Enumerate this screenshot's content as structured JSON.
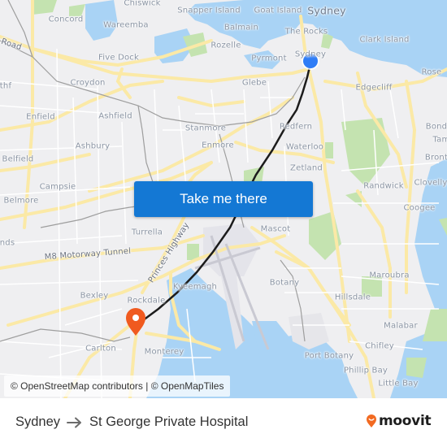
{
  "map": {
    "colors": {
      "land": "#efeff1",
      "water": "#a9d3f5",
      "park": "#c4e3b0",
      "major_road": "#fbe9a6",
      "minor_road": "#ffffff",
      "rail": "#9e9e9e",
      "route_line": "#1c1c1c",
      "origin_marker": "#2f7df6",
      "destination_marker": "#f05a1f"
    },
    "places": [
      {
        "name": "Chiswick"
      },
      {
        "name": "Snapper Island"
      },
      {
        "name": "Goat Island"
      },
      {
        "name": "Sydney",
        "emphasis": "city"
      },
      {
        "name": "Concord"
      },
      {
        "name": "Wareemba"
      },
      {
        "name": "Balmain"
      },
      {
        "name": "The Rocks"
      },
      {
        "name": "Clark Island"
      },
      {
        "name": "Road"
      },
      {
        "name": "Rozelle"
      },
      {
        "name": "Five Dock"
      },
      {
        "name": "Pyrmont"
      },
      {
        "name": "Sydney"
      },
      {
        "name": "Rose"
      },
      {
        "name": "thf"
      },
      {
        "name": "Croydon"
      },
      {
        "name": "Glebe"
      },
      {
        "name": "Edgecliff"
      },
      {
        "name": "Enfield"
      },
      {
        "name": "Ashfield"
      },
      {
        "name": "Stanmore"
      },
      {
        "name": "Redfern"
      },
      {
        "name": "Bond"
      },
      {
        "name": "Ashbury"
      },
      {
        "name": "Enmore"
      },
      {
        "name": "Waterloo"
      },
      {
        "name": "Tam"
      },
      {
        "name": "Belfield"
      },
      {
        "name": "Bront"
      },
      {
        "name": "Zetland"
      },
      {
        "name": "Campsie"
      },
      {
        "name": "Randwick"
      },
      {
        "name": "Clovelly"
      },
      {
        "name": "Belmore"
      },
      {
        "name": "Coogee"
      },
      {
        "name": "Turrella"
      },
      {
        "name": "Mascot"
      },
      {
        "name": "nds"
      },
      {
        "name": "M8 Motorway Tunnel"
      },
      {
        "name": "Princes Highway"
      },
      {
        "name": "Maroubra"
      },
      {
        "name": "Kyeemagh"
      },
      {
        "name": "Botany"
      },
      {
        "name": "Bexley"
      },
      {
        "name": "Rockdale"
      },
      {
        "name": "Hillsdale"
      },
      {
        "name": "Malabar"
      },
      {
        "name": "Carlton"
      },
      {
        "name": "Monterey"
      },
      {
        "name": "Chifley"
      },
      {
        "name": "Port Botany"
      },
      {
        "name": "Phillip Bay"
      },
      {
        "name": "Little Bay"
      }
    ],
    "origin": {
      "name": "Sydney",
      "icon": "origin-dot-icon"
    },
    "destination": {
      "name": "St George Private Hospital",
      "icon": "destination-pin-icon"
    },
    "cta_label": "Take me there",
    "attribution": "© OpenStreetMap contributors | © OpenMapTiles"
  },
  "footer": {
    "from": "Sydney",
    "arrow_icon": "arrow-right-icon",
    "to": "St George Private Hospital",
    "brand": "moovit",
    "brand_icon": "moovit-pin-icon",
    "brand_color": "#f26a21"
  }
}
